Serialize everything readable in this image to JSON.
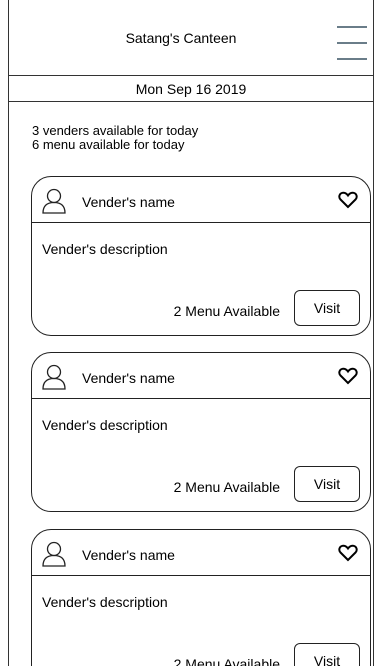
{
  "header": {
    "title": "Satang's Canteen",
    "menu_icon": "hamburger-menu-icon"
  },
  "date_bar": {
    "date": "Mon Sep 16 2019"
  },
  "summary": {
    "venders_line": "3 venders available for today",
    "menu_line": "6 menu available for today"
  },
  "cards": [
    {
      "name": "Vender's name",
      "description": "Vender's description",
      "available": "2 Menu Available",
      "visit_label": "Visit",
      "avatar_icon": "user-icon",
      "favorite_icon": "heart-icon"
    },
    {
      "name": "Vender's name",
      "description": "Vender's description",
      "available": "2 Menu Available",
      "visit_label": "Visit",
      "avatar_icon": "user-icon",
      "favorite_icon": "heart-icon"
    },
    {
      "name": "Vender's name",
      "description": "Vender's description",
      "available": "2 Menu Available",
      "visit_label": "Visit",
      "avatar_icon": "user-icon",
      "favorite_icon": "heart-icon"
    }
  ],
  "colors": {
    "menu_icon": "#6a7d89",
    "border": "#222222",
    "background": "#ffffff"
  }
}
